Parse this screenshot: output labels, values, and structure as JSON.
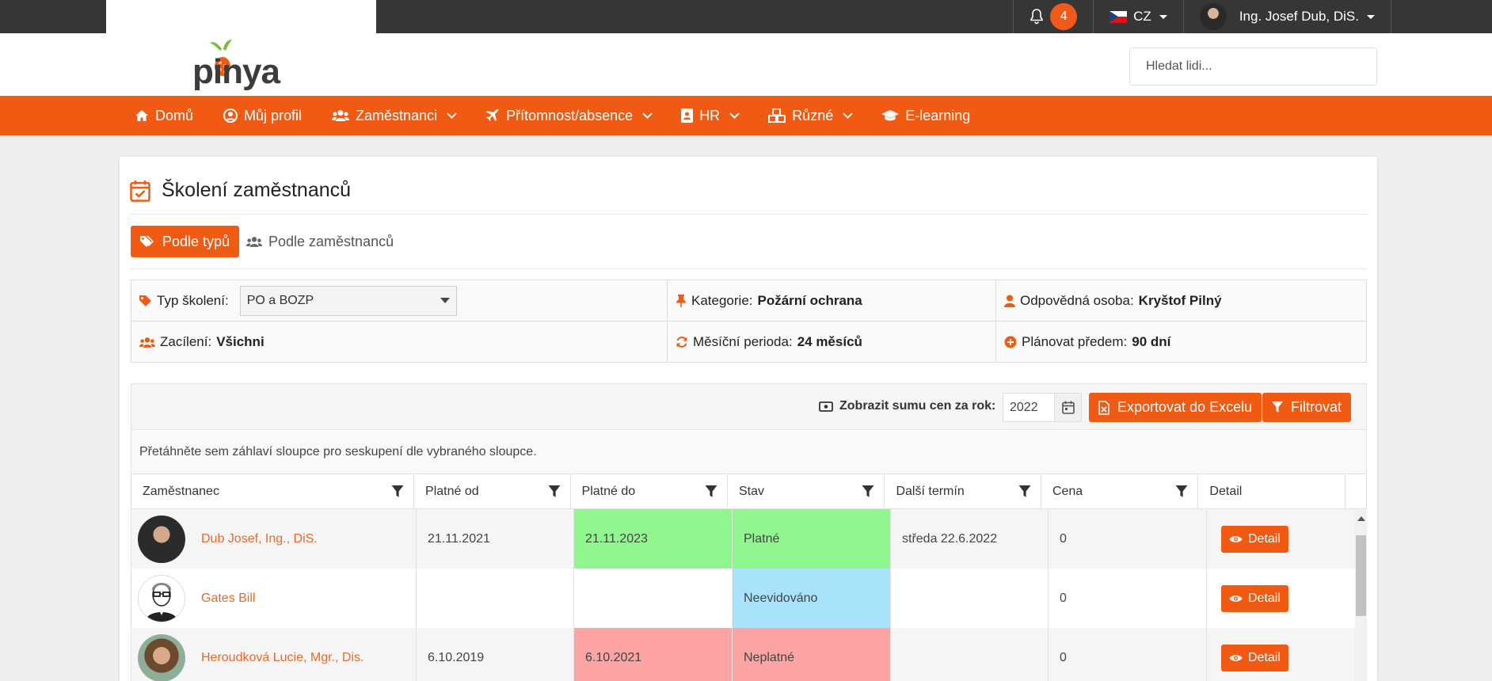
{
  "topbar": {
    "notifications_count": "4",
    "language": "CZ",
    "user_name": "Ing. Josef Dub, DiS."
  },
  "header": {
    "logo_text": "pinya",
    "search_placeholder": "Hledat lidi..."
  },
  "nav": {
    "items": [
      {
        "label": "Domů",
        "icon": "home-icon",
        "dropdown": false
      },
      {
        "label": "Můj profil",
        "icon": "user-circle-icon",
        "dropdown": false
      },
      {
        "label": "Zaměstnanci",
        "icon": "users-icon",
        "dropdown": true
      },
      {
        "label": "Přítomnost/absence",
        "icon": "plane-icon",
        "dropdown": true
      },
      {
        "label": "HR",
        "icon": "id-badge-icon",
        "dropdown": true
      },
      {
        "label": "Různé",
        "icon": "cubes-icon",
        "dropdown": true
      },
      {
        "label": "E-learning",
        "icon": "graduation-cap-icon",
        "dropdown": false
      }
    ]
  },
  "page": {
    "title": "Školení zaměstnanců",
    "tabs": {
      "by_type": "Podle typů",
      "by_employee": "Podle zaměstnanců"
    }
  },
  "info": {
    "type_label": "Typ školení:",
    "type_value": "PO a BOZP",
    "category_label": "Kategorie:",
    "category_value": "Požární ochrana",
    "responsible_label": "Odpovědná osoba:",
    "responsible_value": "Kryštof Pilný",
    "target_label": "Zacílení:",
    "target_value": "Všichni",
    "period_label": "Měsíční perioda:",
    "period_value": "24 měsíců",
    "plan_label": "Plánovat předem:",
    "plan_value": "90 dní"
  },
  "grid": {
    "sum_label": "Zobrazit sumu cen za rok:",
    "year": "2022",
    "export_label": "Exportovat do Excelu",
    "filter_label": "Filtrovat",
    "group_hint": "Přetáhněte sem záhlaví sloupce pro seskupení dle vybraného sloupce.",
    "columns": [
      "Zaměstnanec",
      "Platné od",
      "Platné do",
      "Stav",
      "Další termín",
      "Cena",
      "Detail"
    ],
    "rows": [
      {
        "employee": "Dub Josef, Ing., DiS.",
        "valid_from": "21.11.2021",
        "valid_to": "21.11.2023",
        "status": "Platné",
        "status_color": "#90f78e",
        "next": "středa 22.6.2022",
        "price": "0",
        "detail": "Detail"
      },
      {
        "employee": "Gates Bill",
        "valid_from": "",
        "valid_to": "",
        "status": "Neevidováno",
        "status_color": "#a8e2fb",
        "next": "",
        "price": "0",
        "detail": "Detail"
      },
      {
        "employee": "Heroudková Lucie, Mgr., Dis.",
        "valid_from": "6.10.2019",
        "valid_to": "6.10.2021",
        "status": "Neplatné",
        "status_color": "#fca3a3",
        "next": "",
        "price": "0",
        "detail": "Detail"
      }
    ]
  },
  "colors": {
    "accent": "#f05a12",
    "topbar": "#363636",
    "valid": "#90f78e",
    "unrecorded": "#a8e2fb",
    "invalid": "#fca3a3"
  }
}
